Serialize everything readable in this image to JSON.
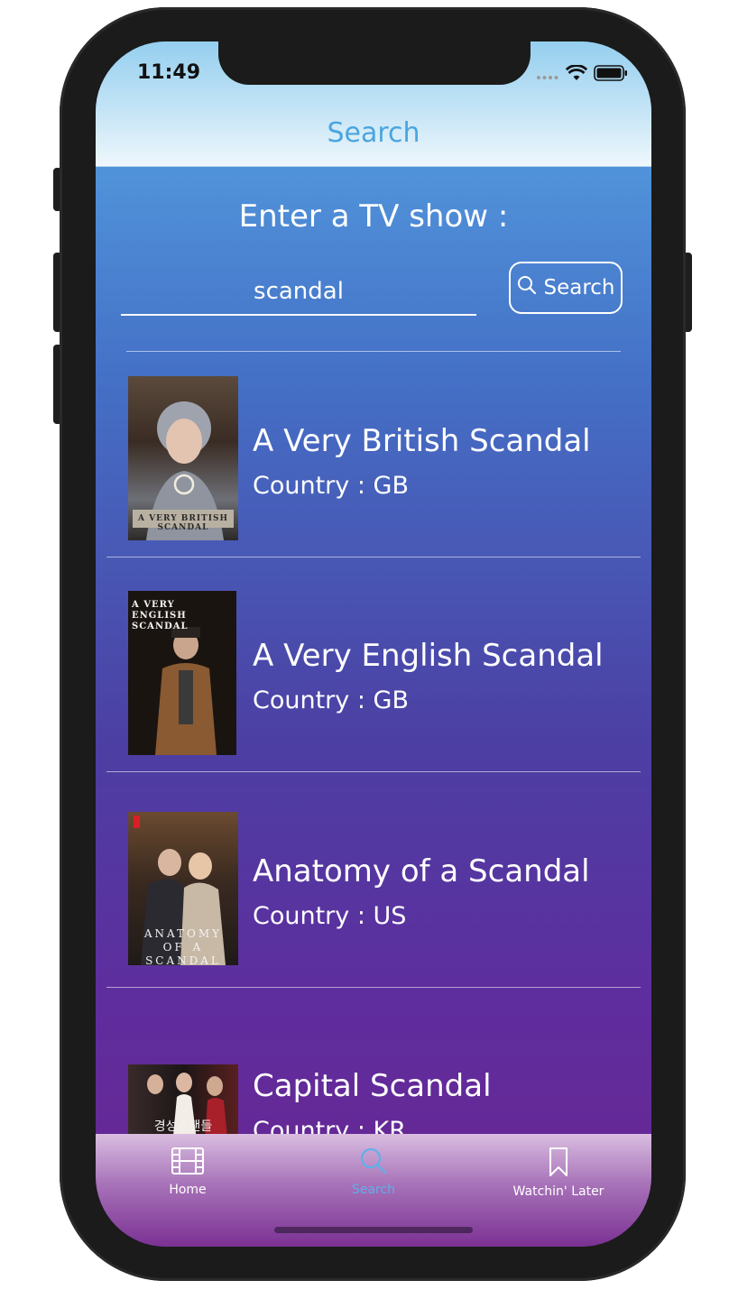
{
  "status_bar": {
    "time": "11:49"
  },
  "nav": {
    "title": "Search"
  },
  "search": {
    "prompt": "Enter a TV show :",
    "query": "scandal",
    "button_label": "Search"
  },
  "results": [
    {
      "title": "A Very British Scandal",
      "country": "Country : GB",
      "poster_caption": "A VERY BRITISH SCANDAL"
    },
    {
      "title": "A Very English Scandal",
      "country": "Country : GB",
      "poster_caption": "A VERY ENGLISH SCANDAL"
    },
    {
      "title": "Anatomy of a Scandal",
      "country": "Country : US",
      "poster_caption": "ANATOMY OF A SCANDAL"
    },
    {
      "title": "Capital Scandal",
      "country": "Country : KR",
      "poster_caption": "경성스캔들"
    }
  ],
  "tabs": [
    {
      "label": "Home",
      "icon": "film-icon"
    },
    {
      "label": "Search",
      "icon": "search-icon"
    },
    {
      "label": "Watchin' Later",
      "icon": "bookmark-icon"
    }
  ],
  "colors": {
    "accent": "#4aa5df",
    "text": "#ffffff"
  }
}
